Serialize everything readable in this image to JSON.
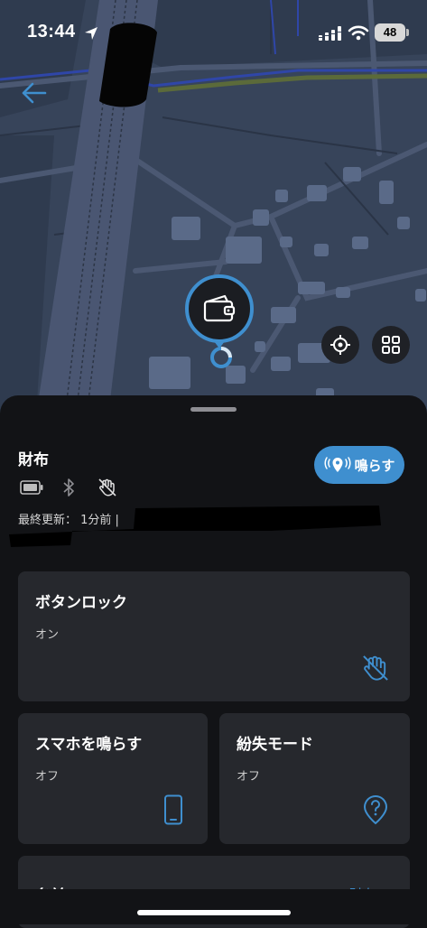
{
  "status_bar": {
    "time": "13:44",
    "battery": "48",
    "icons": [
      "location-arrow-icon",
      "signal-icon",
      "wifi-icon",
      "battery-icon"
    ]
  },
  "map": {
    "controls": [
      "back-arrow-icon",
      "recenter-icon",
      "grid-icon"
    ],
    "pin_icon": "wallet-icon"
  },
  "item": {
    "name": "財布",
    "status_icons": [
      "battery-icon",
      "bluetooth-icon",
      "hand-off-icon"
    ],
    "last_updated": "最終更新： 1分前 |"
  },
  "ring_button": {
    "label": "鳴らす",
    "icon": "ring-location-icon"
  },
  "cards": {
    "button_lock": {
      "title": "ボタンロック",
      "value": "オン",
      "icon": "hand-off-icon"
    },
    "ring_phone": {
      "title": "スマホを鳴らす",
      "value": "オフ",
      "icon": "phone-icon"
    },
    "lost_mode": {
      "title": "紛失モード",
      "value": "オフ",
      "icon": "question-pin-icon"
    },
    "name": {
      "title": "名前",
      "link": "財布 >"
    }
  },
  "colors": {
    "accent": "#3f8fcf",
    "card_bg": "#26282d",
    "sheet_bg": "#121316",
    "map_bg": "#37445a"
  }
}
